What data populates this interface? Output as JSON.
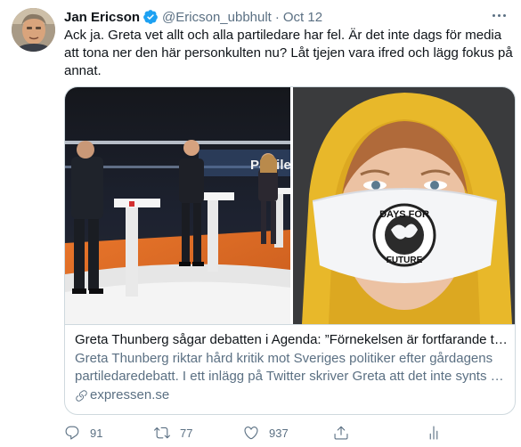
{
  "tweet": {
    "author_name": "Jan Ericson",
    "author_handle": "@Ericson_ubbhult",
    "separator": "·",
    "date": "Oct 12",
    "text": "Ack ja. Greta vet allt och alla partiledare har fel. Är det inte dags för media att tona ner den här personkulten nu? Låt tjejen vara ifred och lägg fokus på annat.",
    "verified": true
  },
  "card": {
    "title": "Greta Thunberg sågar debatten i Agenda: ”Förnekelsen är fortfarande t…",
    "description": "Greta Thunberg riktar hård kritik mot Sveriges politiker efter gårdagens partiledaredebatt. I ett inlägg på Twitter skriver Greta att det inte synts …",
    "domain": "expressen.se",
    "image_left_text": "Partile",
    "mask_text_top": "DAYS FOR",
    "mask_text_bottom": "FUTURE"
  },
  "actions": {
    "replies": "91",
    "retweets": "77",
    "likes": "937"
  },
  "icons": {
    "verified": "verified-badge-icon",
    "more": "more-icon",
    "link": "link-icon",
    "reply": "reply-icon",
    "retweet": "retweet-icon",
    "like": "heart-icon",
    "share": "share-icon",
    "analytics": "analytics-icon"
  },
  "colors": {
    "accent": "#1da1f2",
    "secondary_text": "#5b7083",
    "border": "#cfd9de",
    "hood_yellow": "#e8b82a"
  }
}
